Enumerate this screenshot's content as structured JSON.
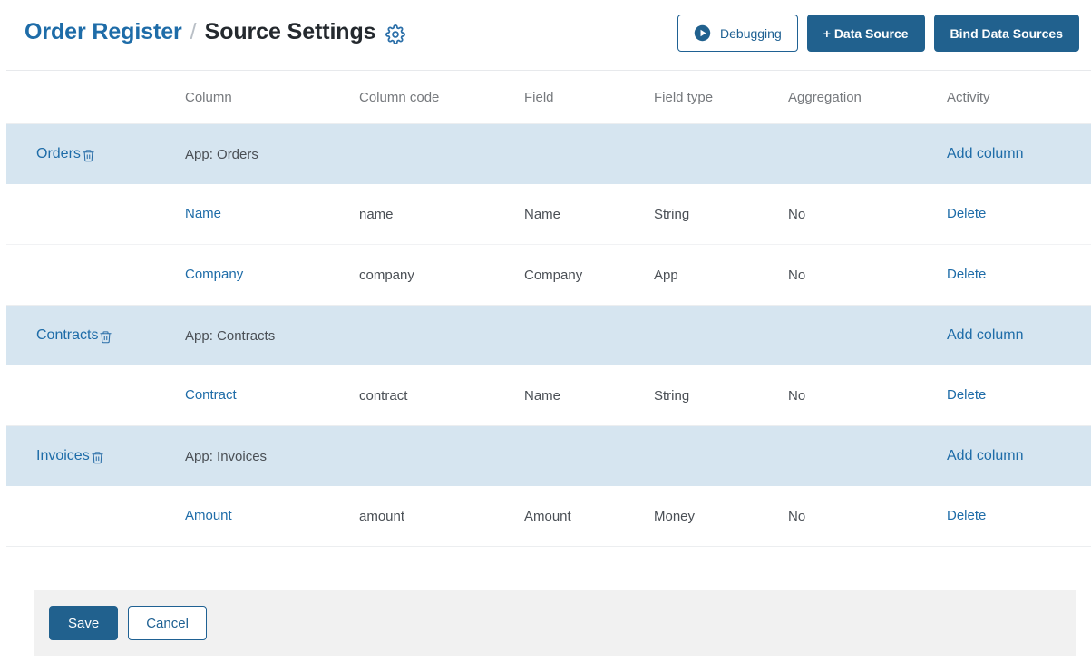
{
  "header": {
    "breadcrumb_root": "Order Register",
    "breadcrumb_sep": "/",
    "breadcrumb_current": "Source Settings",
    "settings_icon": "gear-icon",
    "actions": {
      "debugging_label": "Debugging",
      "debugging_icon": "play-circle-icon",
      "add_data_source_label": "+ Data Source",
      "bind_data_sources_label": "Bind Data Sources"
    }
  },
  "table": {
    "headers": {
      "source": "",
      "column": "Column",
      "column_code": "Column code",
      "field": "Field",
      "field_type": "Field type",
      "aggregation": "Aggregation",
      "activity": "Activity"
    },
    "groups": [
      {
        "source_name": "Orders",
        "delete_icon": "trash-icon",
        "app_label": "App: Orders",
        "add_column_label": "Add column",
        "rows": [
          {
            "column": "Name",
            "column_code": "name",
            "field": "Name",
            "field_type": "String",
            "aggregation": "No",
            "activity": "Delete"
          },
          {
            "column": "Company",
            "column_code": "company",
            "field": "Company",
            "field_type": "App",
            "aggregation": "No",
            "activity": "Delete"
          }
        ]
      },
      {
        "source_name": "Contracts",
        "delete_icon": "trash-icon",
        "app_label": "App: Contracts",
        "add_column_label": "Add column",
        "rows": [
          {
            "column": "Contract",
            "column_code": "contract",
            "field": "Name",
            "field_type": "String",
            "aggregation": "No",
            "activity": "Delete"
          }
        ]
      },
      {
        "source_name": "Invoices",
        "delete_icon": "trash-icon",
        "app_label": "App: Invoices",
        "add_column_label": "Add column",
        "rows": [
          {
            "column": "Amount",
            "column_code": "amount",
            "field": "Amount",
            "field_type": "Money",
            "aggregation": "No",
            "activity": "Delete"
          }
        ]
      }
    ]
  },
  "footer": {
    "save_label": "Save",
    "cancel_label": "Cancel"
  },
  "colors": {
    "primary": "#21618e",
    "link": "#1e6ca8",
    "group_row_bg": "#d6e5f0",
    "footer_bg": "#f1f1f1",
    "text": "#4a4f55",
    "muted": "#76797d"
  }
}
